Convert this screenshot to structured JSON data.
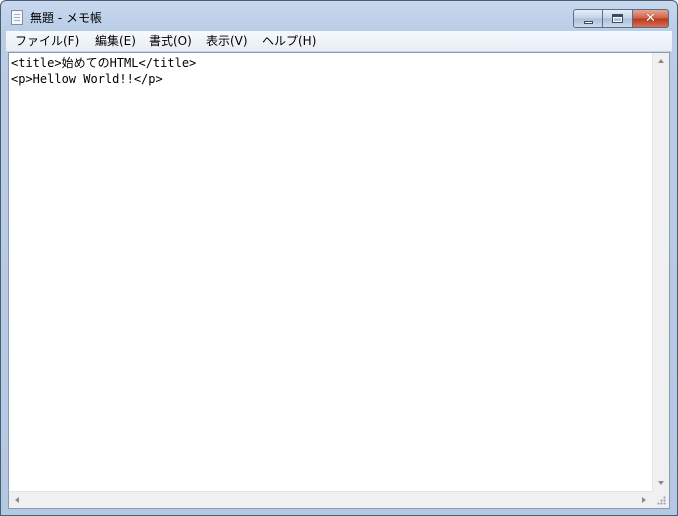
{
  "window": {
    "title": "無題 - メモ帳",
    "controls": {
      "minimize": "minimize-icon",
      "maximize": "maximize-icon",
      "close": "close-icon",
      "close_glyph": "✕"
    }
  },
  "menu": {
    "items": [
      {
        "label": "ファイル(F)"
      },
      {
        "label": "編集(E)"
      },
      {
        "label": "書式(O)"
      },
      {
        "label": "表示(V)"
      },
      {
        "label": "ヘルプ(H)"
      }
    ]
  },
  "editor": {
    "lines": [
      "<title>始めてのHTML</title>",
      "<p>Hellow World!!</p>"
    ]
  },
  "colors": {
    "frame": "#b9cde6",
    "close_button": "#c7452a",
    "editor_bg": "#ffffff"
  }
}
